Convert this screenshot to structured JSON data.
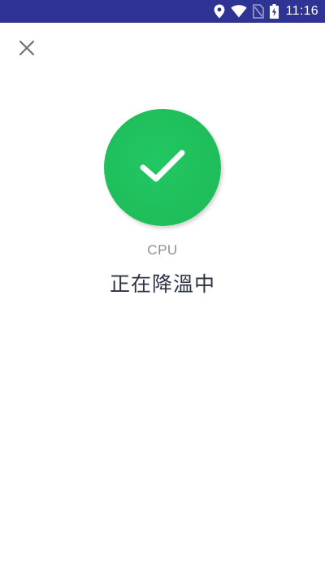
{
  "status_bar": {
    "time": "11:16",
    "background_color": "#2f3494",
    "icons": [
      "location-icon",
      "wifi-icon",
      "no-sim-icon",
      "battery-charging-icon"
    ]
  },
  "toolbar": {
    "close_icon": "close-icon"
  },
  "result": {
    "icon": "checkmark-icon",
    "circle_color": "#1ebd5a",
    "component_label": "CPU",
    "status_text": "正在降溫中"
  }
}
